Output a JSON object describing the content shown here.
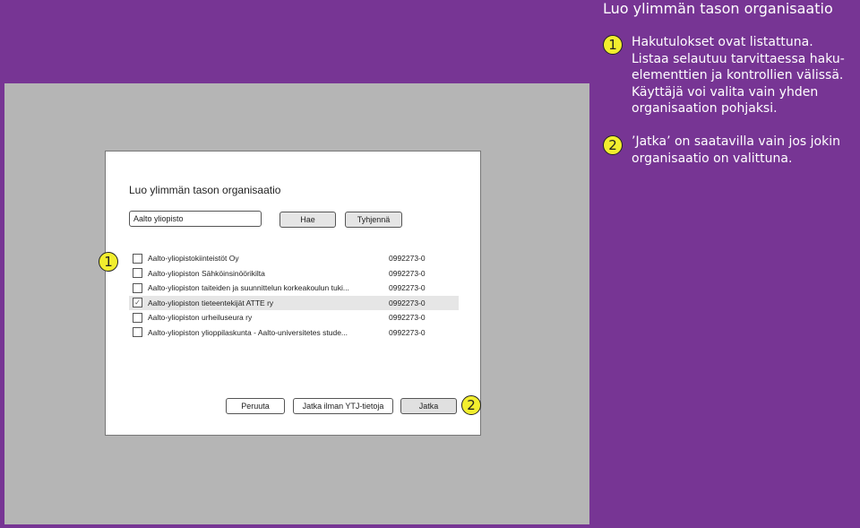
{
  "page_title": "Luo ylimmän tason organisaatio",
  "notes": [
    {
      "marker": "1",
      "lines": [
        "Hakutulokset ovat listattuna.",
        "Listaa selautuu tarvittaessa haku-",
        "elementtien ja kontrollien välissä.",
        "Käyttäjä voi valita vain yhden",
        "organisaation pohjaksi."
      ]
    },
    {
      "marker": "2",
      "lines": [
        "’Jatka’ on saatavilla vain jos jokin",
        "organisaatio on valittuna."
      ]
    }
  ],
  "dialog": {
    "title": "Luo ylimmän tason organisaatio",
    "search": {
      "value": "Aalto yliopisto",
      "placeholder": ""
    },
    "search_button": "Hae",
    "clear_button": "Tyhjennä",
    "results": [
      {
        "name": "Aalto-yliopistokiinteistöt Oy",
        "code": "0992273-0",
        "checked": false
      },
      {
        "name": "Aalto-yliopiston Sähköinsinöörikilta",
        "code": "0992273-0",
        "checked": false
      },
      {
        "name": "Aalto-yliopiston taiteiden ja suunnittelun korkeakoulun tuki...",
        "code": "0992273-0",
        "checked": false
      },
      {
        "name": "Aalto-yliopiston tieteentekijät ATTE ry",
        "code": "0992273-0",
        "checked": true
      },
      {
        "name": "Aalto-yliopiston urheiluseura ry",
        "code": "0992273-0",
        "checked": false
      },
      {
        "name": "Aalto-yliopiston ylioppilaskunta - Aalto-universitetes stude...",
        "code": "0992273-0",
        "checked": false
      }
    ],
    "cancel_button": "Peruuta",
    "skip_button": "Jatka ilman YTJ-tietoja",
    "continue_button": "Jatka"
  },
  "markers": {
    "results": "1",
    "continue": "2"
  },
  "colors": {
    "background": "#773594",
    "marker": "#f2ee2e",
    "canvas": "#b5b5b5"
  }
}
